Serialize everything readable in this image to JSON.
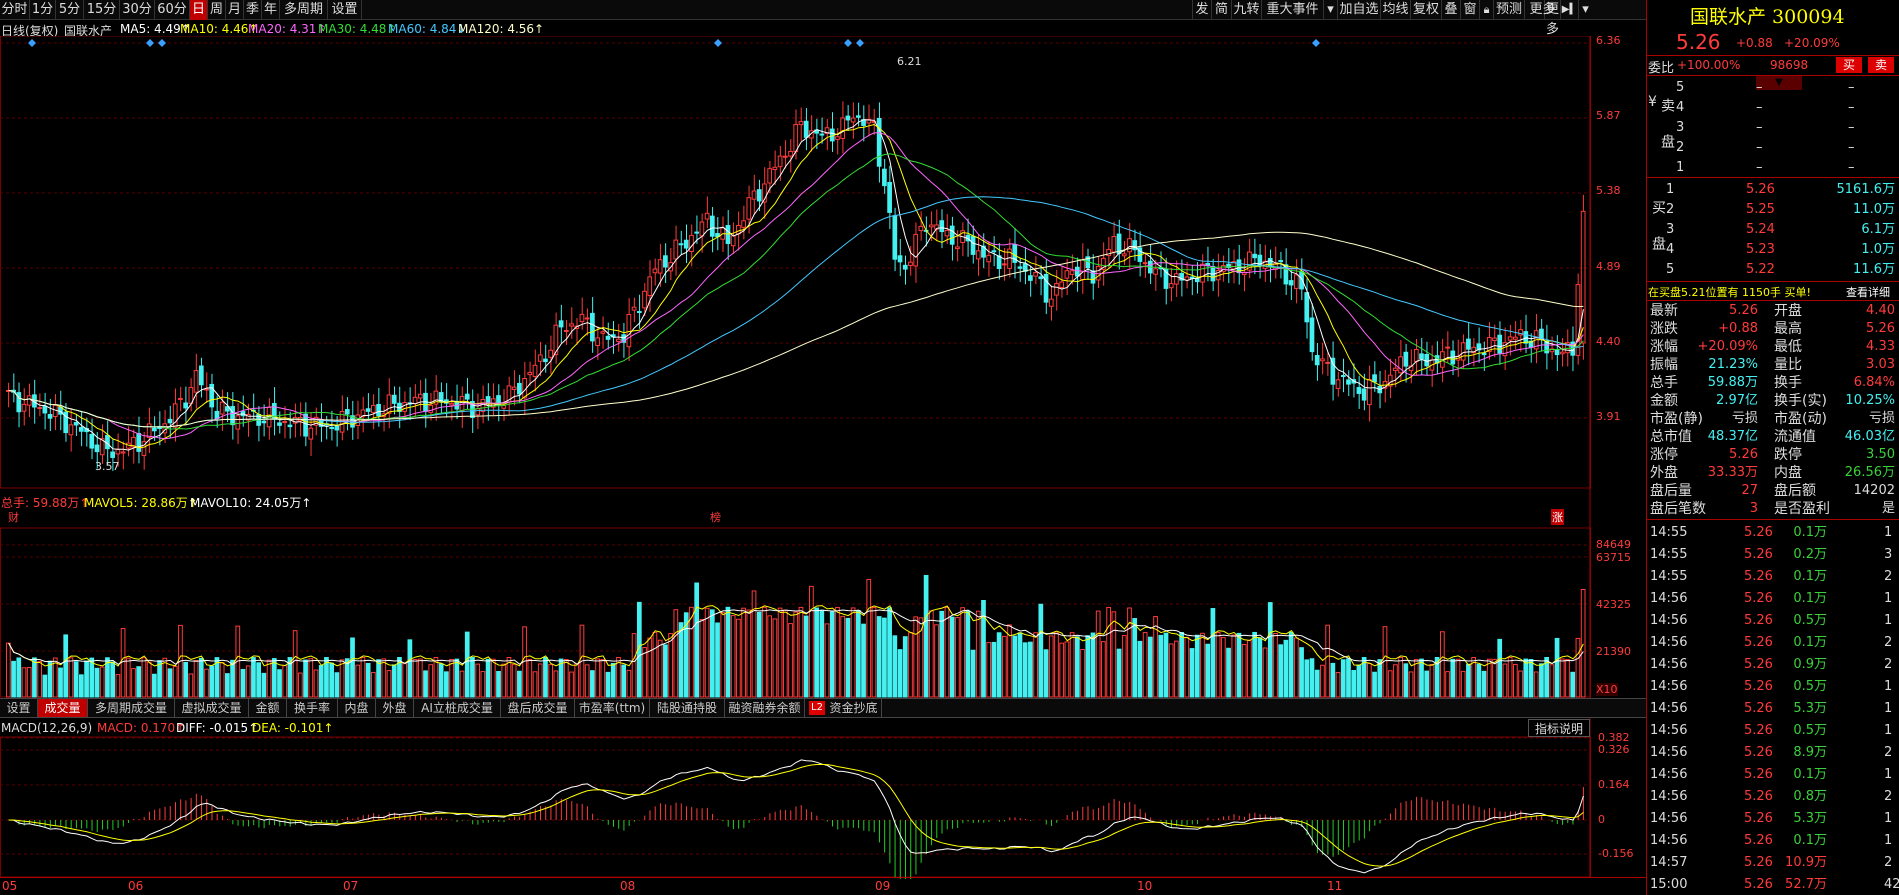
{
  "toolbar": {
    "periods": [
      "分时",
      "1分",
      "5分",
      "15分",
      "30分",
      "60分",
      "日",
      "周",
      "月",
      "季",
      "年",
      "多周期",
      "设置"
    ],
    "selected_period": "日",
    "right_tools": [
      "发",
      "简",
      "九转",
      "重大事件",
      "▾",
      "加自选",
      "均线",
      "复权",
      "叠",
      "窗",
      "预测",
      "更多",
      "▾"
    ]
  },
  "chart_header": {
    "period_label": "日线(复权)",
    "stock_name": "国联水产",
    "ma": [
      {
        "label": "MA5: 4.49↑",
        "color": "#ffffff"
      },
      {
        "label": "MA10: 4.46↑",
        "color": "#ffff00"
      },
      {
        "label": "MA20: 4.31↑",
        "color": "#ff66ff"
      },
      {
        "label": "MA30: 4.48↑",
        "color": "#33dd33"
      },
      {
        "label": "MA60: 4.84↓",
        "color": "#44c8ff"
      },
      {
        "label": "MA120: 4.56↑",
        "color": "#ffffcc"
      }
    ]
  },
  "price_axis": [
    "6.36",
    "5.87",
    "5.38",
    "4.89",
    "4.40",
    "3.91"
  ],
  "price_annotations": {
    "high": "6.21",
    "low": "3.57"
  },
  "event_markers": [
    "财",
    "榜",
    "涨"
  ],
  "volume_header": {
    "total": "总手: 59.88万↑",
    "mavol5": "MAVOL5: 28.86万↑",
    "mavol10": "MAVOL10: 24.05万↑"
  },
  "volume_axis": [
    "84649",
    "63715",
    "42325",
    "21390",
    "X10"
  ],
  "indicator_tabs": [
    "设置",
    "成交量",
    "多周期成交量",
    "虚拟成交量",
    "金额",
    "换手率",
    "内盘",
    "外盘",
    "AI立桩成交量",
    "盘后成交量",
    "市盈率(ttm)",
    "陆股通持股",
    "融资融券余额",
    "资金抄底"
  ],
  "indicator_selected": "成交量",
  "l2_badge": "L2",
  "macd_header": {
    "name": "MACD(12,26,9)",
    "macd": "MACD: 0.170↑",
    "diff": "DIFF: -0.015↑",
    "dea": "DEA: -0.101↑"
  },
  "macd_help": "指标说明",
  "macd_axis": [
    "0.382",
    "0.326",
    "0.164",
    "0",
    "-0.156"
  ],
  "x_axis": [
    "05",
    "06",
    "07",
    "08",
    "09",
    "10",
    "11"
  ],
  "sidebar": {
    "title": "国联水产 300094",
    "price": "5.26",
    "change": "+0.88",
    "change_pct": "+20.09%",
    "weibi_label": "委比",
    "weibi": "+100.00%",
    "weicha": "98698",
    "buy_btn": "买",
    "sell_btn": "卖",
    "ask_side": "卖盘",
    "bid_side": "买盘",
    "asks": [
      {
        "n": "5",
        "p": "–",
        "v": "–"
      },
      {
        "n": "4",
        "p": "–",
        "v": "–"
      },
      {
        "n": "3",
        "p": "–",
        "v": "–"
      },
      {
        "n": "2",
        "p": "–",
        "v": "–"
      },
      {
        "n": "1",
        "p": "–",
        "v": "–"
      }
    ],
    "bids": [
      {
        "n": "1",
        "p": "5.26",
        "v": "5161.6万"
      },
      {
        "n": "2",
        "p": "5.25",
        "v": "11.0万"
      },
      {
        "n": "3",
        "p": "5.24",
        "v": "6.1万"
      },
      {
        "n": "4",
        "p": "5.23",
        "v": "1.0万"
      },
      {
        "n": "5",
        "p": "5.22",
        "v": "11.6万"
      }
    ],
    "notice": "在买盘5.21位置有 1150手 买单!",
    "notice_link": "查看详细",
    "stats": [
      [
        "最新",
        "5.26",
        "开盘",
        "4.40"
      ],
      [
        "涨跌",
        "+0.88",
        "最高",
        "5.26"
      ],
      [
        "涨幅",
        "+20.09%",
        "最低",
        "4.33"
      ],
      [
        "振幅",
        "21.23%",
        "量比",
        "3.03"
      ],
      [
        "总手",
        "59.88万",
        "换手",
        "6.84%"
      ],
      [
        "金额",
        "2.97亿",
        "换手(实)",
        "10.25%"
      ],
      [
        "市盈(静)",
        "亏损",
        "市盈(动)",
        "亏损"
      ],
      [
        "总市值",
        "48.37亿",
        "流通值",
        "46.03亿"
      ],
      [
        "涨停",
        "5.26",
        "跌停",
        "3.50"
      ],
      [
        "外盘",
        "33.33万",
        "内盘",
        "26.56万"
      ],
      [
        "盘后量",
        "27",
        "盘后额",
        "14202"
      ],
      [
        "盘后笔数",
        "3",
        "是否盈利",
        "是"
      ]
    ],
    "ticks": [
      [
        "14:55",
        "5.26",
        "0.1万",
        "1"
      ],
      [
        "14:55",
        "5.26",
        "0.2万",
        "3"
      ],
      [
        "14:55",
        "5.26",
        "0.1万",
        "2"
      ],
      [
        "14:56",
        "5.26",
        "0.1万",
        "1"
      ],
      [
        "14:56",
        "5.26",
        "0.5万",
        "1"
      ],
      [
        "14:56",
        "5.26",
        "0.1万",
        "2"
      ],
      [
        "14:56",
        "5.26",
        "0.9万",
        "2"
      ],
      [
        "14:56",
        "5.26",
        "0.5万",
        "1"
      ],
      [
        "14:56",
        "5.26",
        "5.3万",
        "1"
      ],
      [
        "14:56",
        "5.26",
        "0.5万",
        "1"
      ],
      [
        "14:56",
        "5.26",
        "8.9万",
        "2"
      ],
      [
        "14:56",
        "5.26",
        "0.1万",
        "1"
      ],
      [
        "14:56",
        "5.26",
        "0.8万",
        "2"
      ],
      [
        "14:56",
        "5.26",
        "5.3万",
        "1"
      ],
      [
        "14:56",
        "5.26",
        "0.1万",
        "1"
      ],
      [
        "14:57",
        "5.26",
        "10.9万",
        "2"
      ],
      [
        "15:00",
        "5.26",
        "52.7万",
        "42"
      ]
    ]
  },
  "colors": {
    "up": "#ff3b3b",
    "down": "#44f0f0",
    "bg": "#000000",
    "grid": "#5a0000"
  }
}
